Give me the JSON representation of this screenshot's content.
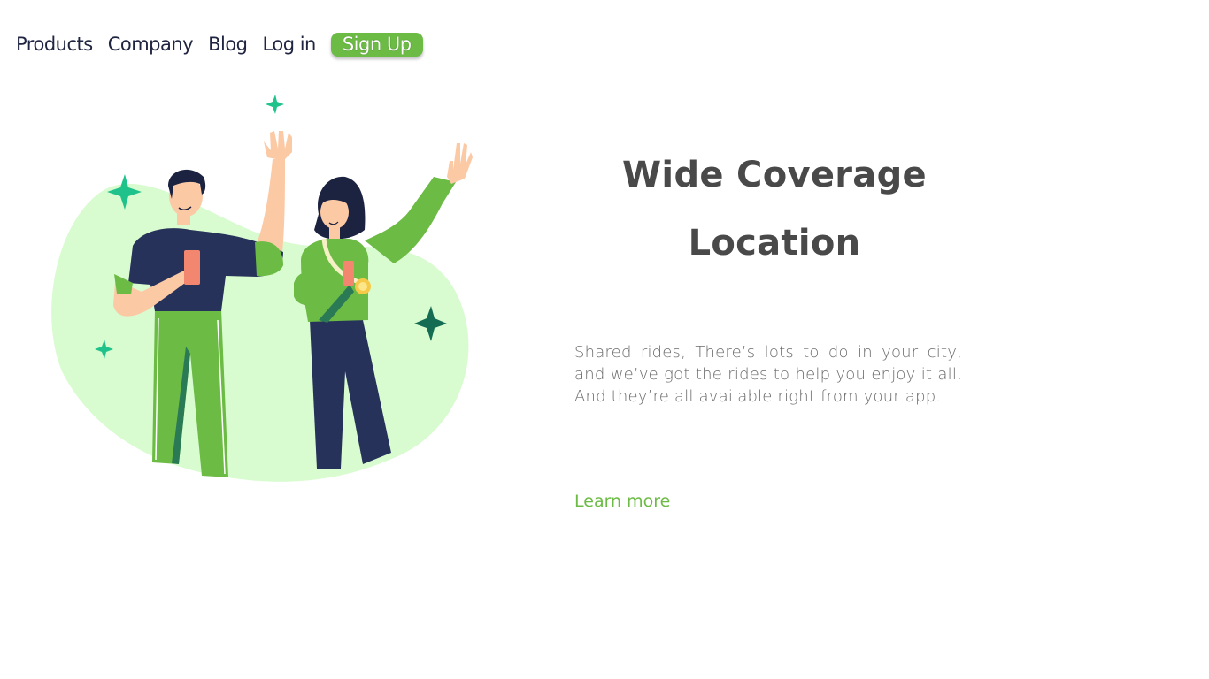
{
  "nav": {
    "items": [
      "Products",
      "Company",
      "Blog",
      "Log in"
    ],
    "signup_label": "Sign Up"
  },
  "hero": {
    "title_line1": "Wide Coverage",
    "title_line2": "Location",
    "description": "Shared rides, There’s lots to do in your city, and we’ve got the rides to help you enjoy it all. And they’re all available right from your app.",
    "link_label": "Learn more"
  },
  "colors": {
    "brand_green": "#6cbb45",
    "nav_text": "#1f2440",
    "title_text": "#494949",
    "body_text": "#6a6a6a",
    "blob": "#d8fcd0",
    "sparkle": "#1fc28a",
    "sparkle_dark": "#146d53",
    "navy": "#27325a"
  },
  "icons": [
    "sparkle-icon"
  ]
}
